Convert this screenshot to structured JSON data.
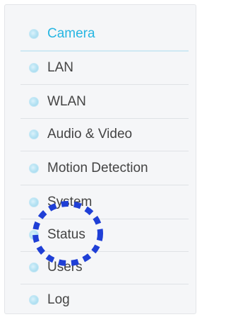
{
  "menu": {
    "items": [
      {
        "label": "Camera",
        "active": true
      },
      {
        "label": "LAN"
      },
      {
        "label": "WLAN"
      },
      {
        "label": "Audio & Video"
      },
      {
        "label": "Motion Detection"
      },
      {
        "label": "System"
      },
      {
        "label": "Status"
      },
      {
        "label": "Users"
      },
      {
        "label": "Log"
      }
    ]
  },
  "colors": {
    "active_text": "#27b6e2",
    "text": "#444444",
    "highlight_ring": "#1f3fd6",
    "bullet": "#b9e4f4"
  }
}
